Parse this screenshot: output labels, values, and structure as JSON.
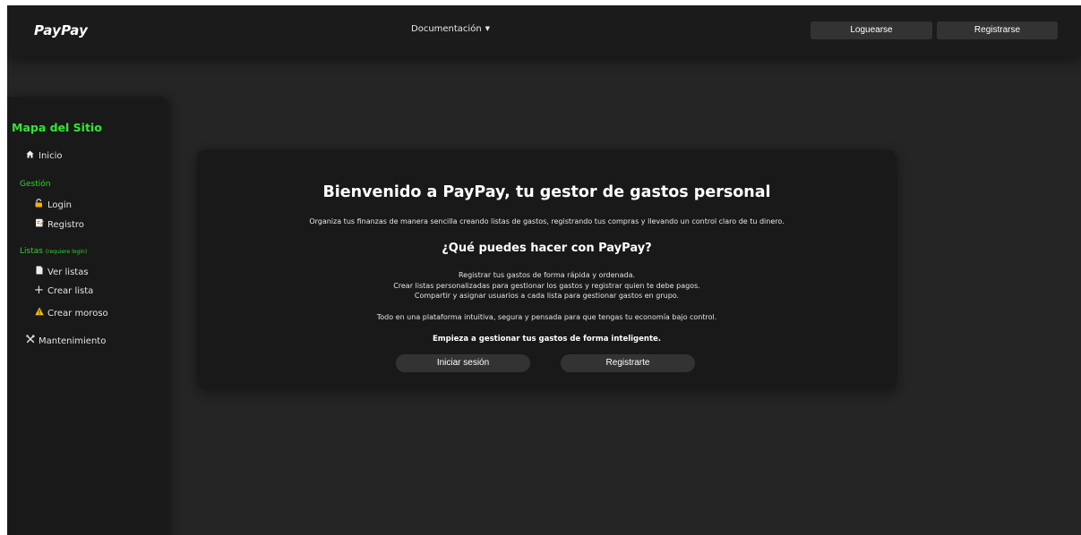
{
  "header": {
    "brand": "PayPay",
    "docs_menu": "Documentación",
    "login_label": "Loguearse",
    "register_label": "Registrarse"
  },
  "sidebar": {
    "title": "Mapa del Sitio",
    "home": {
      "icon": "home-icon",
      "label": "Inicio"
    },
    "management": {
      "label": "Gestión",
      "items": [
        {
          "icon": "lock-icon",
          "label": "Login"
        },
        {
          "icon": "note-icon",
          "label": "Registro"
        }
      ]
    },
    "lists": {
      "label": "Listas",
      "note": "(requiere login)",
      "items": [
        {
          "icon": "document-icon",
          "label": "Ver listas"
        },
        {
          "icon": "plus-icon",
          "label": "Crear lista"
        },
        {
          "icon": "warning-icon",
          "label": "Crear moroso"
        }
      ]
    },
    "maintenance": {
      "icon": "tools-icon",
      "label": "Mantenimiento"
    }
  },
  "main": {
    "title": "Bienvenido a PayPay, tu gestor de gastos personal",
    "intro": "Organiza tus finanzas de manera sencilla creando listas de gastos, registrando tus compras y llevando un control claro de tu dinero.",
    "subtitle": "¿Qué puedes hacer con PayPay?",
    "features": [
      "Registrar tus gastos de forma rápida y ordenada.",
      "Crear listas personalizadas para gestionar los gastos y registrar quien te debe pagos.",
      "Compartir y asignar usuarios a cada lista para gestionar gastos en grupo."
    ],
    "summary": "Todo en una plataforma intuitiva, segura y pensada para que tengas tu economía bajo control.",
    "cta": "Empieza a gestionar tus gastos de forma inteligente.",
    "signin_label": "Iniciar sesión",
    "signup_label": "Registrarte"
  },
  "colors": {
    "accent_green": "#33e633",
    "background": "#252525",
    "panel": "#191919",
    "button": "#333333"
  }
}
